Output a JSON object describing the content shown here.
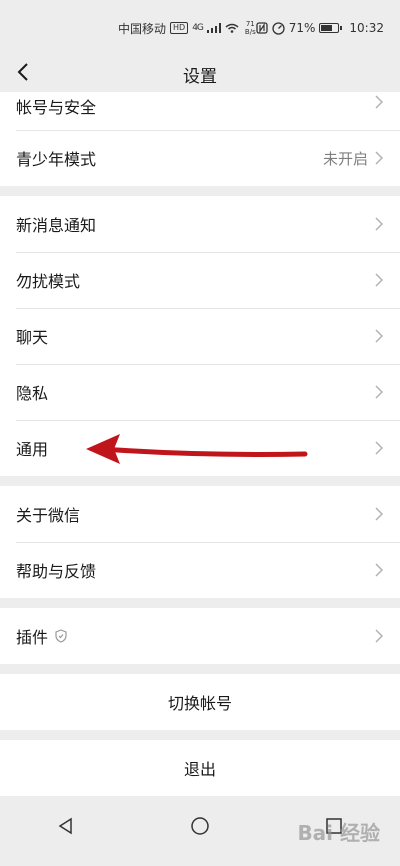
{
  "status": {
    "carrier": "中国移动",
    "hd": "HD",
    "network": "4G",
    "speed_value": "71",
    "speed_unit": "B/s",
    "battery": "71%",
    "time": "10:32"
  },
  "header": {
    "title": "设置"
  },
  "groups": {
    "account": {
      "items": [
        {
          "label": "帐号与安全"
        },
        {
          "label": "青少年模式",
          "value": "未开启"
        }
      ]
    },
    "general": {
      "items": [
        {
          "label": "新消息通知"
        },
        {
          "label": "勿扰模式"
        },
        {
          "label": "聊天"
        },
        {
          "label": "隐私"
        },
        {
          "label": "通用"
        }
      ]
    },
    "about": {
      "items": [
        {
          "label": "关于微信"
        },
        {
          "label": "帮助与反馈"
        }
      ]
    },
    "plugins": {
      "items": [
        {
          "label": "插件"
        }
      ]
    }
  },
  "actions": {
    "switch_account": "切换帐号",
    "logout": "退出"
  },
  "watermark": "Bai 经验",
  "colors": {
    "annotation_arrow": "#c0161b",
    "background": "#ededed",
    "card": "#ffffff"
  }
}
